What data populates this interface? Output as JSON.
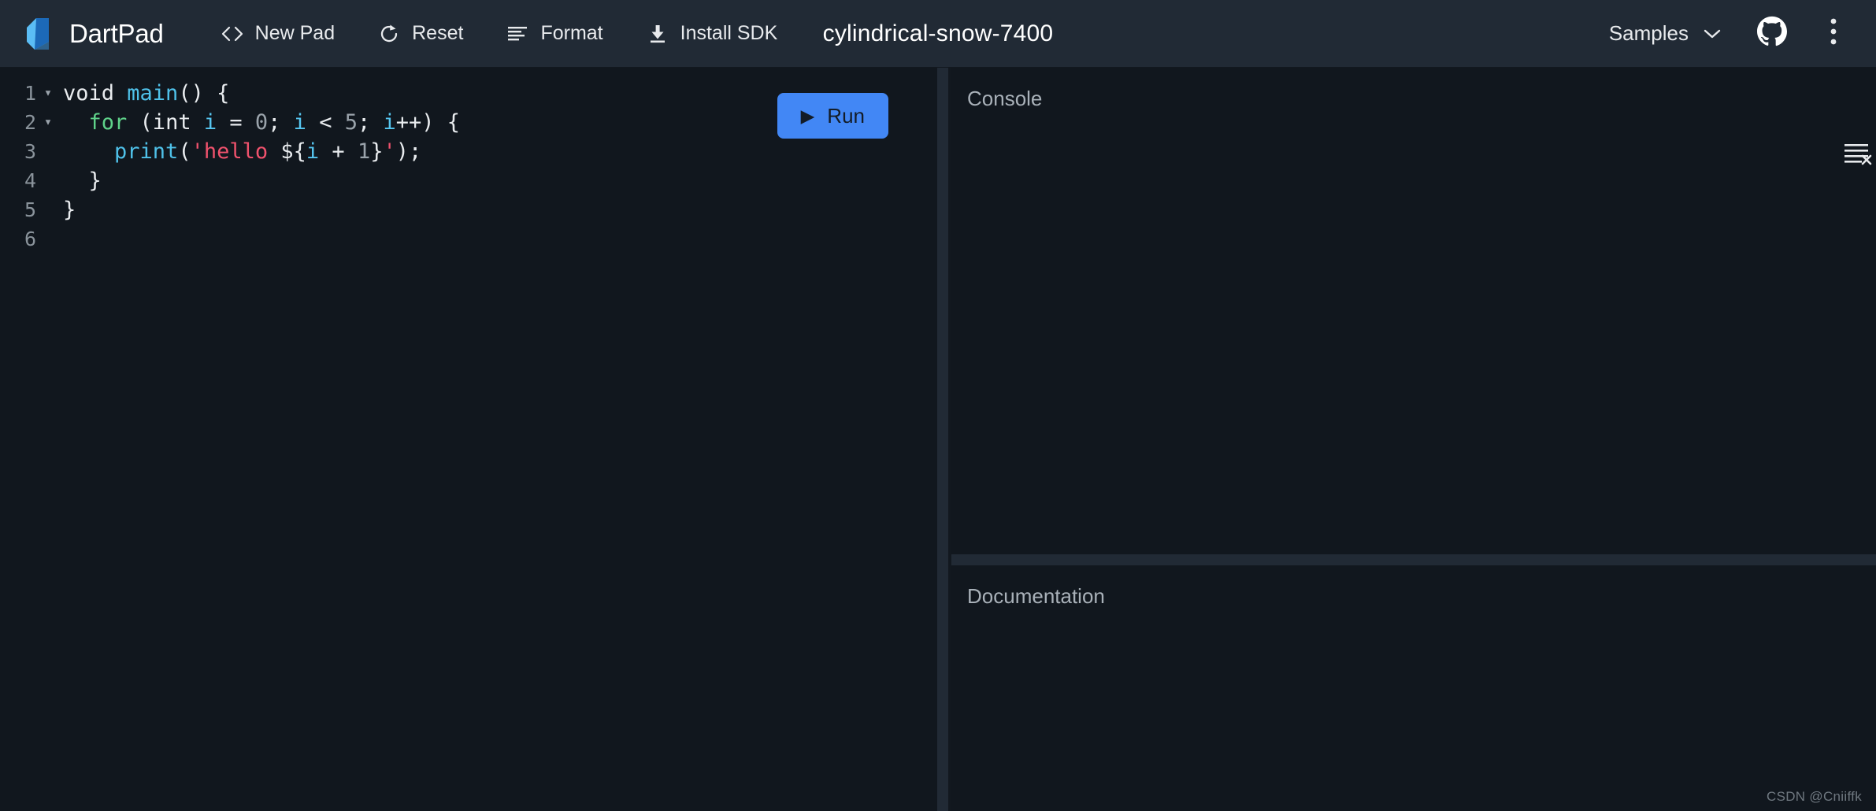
{
  "app": {
    "brand_name": "DartPad",
    "brand_logo_icon": "dart-logo-icon",
    "document_title": "cylindrical-snow-7400",
    "watermark": "CSDN @Cniiffk"
  },
  "header": {
    "actions": [
      {
        "label": "New Pad",
        "icon": "code-brackets-icon"
      },
      {
        "label": "Reset",
        "icon": "refresh-icon"
      },
      {
        "label": "Format",
        "icon": "format-align-left-icon"
      },
      {
        "label": "Install SDK",
        "icon": "download-icon"
      }
    ],
    "samples": {
      "label": "Samples",
      "icon": "chevron-down-icon"
    },
    "github": {
      "icon": "github-icon",
      "label": "GitHub"
    },
    "overflow": {
      "icon": "more-vertical-icon",
      "label": "More actions"
    }
  },
  "editor": {
    "run_button": {
      "label": "Run",
      "icon": "play-icon"
    },
    "gutter_fold_marker": "▾",
    "lines": [
      {
        "number": "1",
        "foldable": true,
        "tokens": [
          {
            "t": "void ",
            "c": "t-plain"
          },
          {
            "t": "main",
            "c": "t-fn"
          },
          {
            "t": "() {",
            "c": "t-punc"
          }
        ]
      },
      {
        "number": "2",
        "foldable": true,
        "tokens": [
          {
            "t": "  ",
            "c": "t-plain"
          },
          {
            "t": "for",
            "c": "t-kw"
          },
          {
            "t": " (int ",
            "c": "t-plain"
          },
          {
            "t": "i",
            "c": "t-var"
          },
          {
            "t": " = ",
            "c": "t-plain"
          },
          {
            "t": "0",
            "c": "t-num"
          },
          {
            "t": "; ",
            "c": "t-punc"
          },
          {
            "t": "i",
            "c": "t-var"
          },
          {
            "t": " < ",
            "c": "t-plain"
          },
          {
            "t": "5",
            "c": "t-num"
          },
          {
            "t": "; ",
            "c": "t-punc"
          },
          {
            "t": "i",
            "c": "t-var"
          },
          {
            "t": "++) {",
            "c": "t-punc"
          }
        ]
      },
      {
        "number": "3",
        "foldable": false,
        "tokens": [
          {
            "t": "    ",
            "c": "t-plain"
          },
          {
            "t": "print",
            "c": "t-fn"
          },
          {
            "t": "(",
            "c": "t-punc"
          },
          {
            "t": "'hello ",
            "c": "t-str"
          },
          {
            "t": "${",
            "c": "t-plain"
          },
          {
            "t": "i",
            "c": "t-var"
          },
          {
            "t": " + ",
            "c": "t-plain"
          },
          {
            "t": "1",
            "c": "t-num"
          },
          {
            "t": "}",
            "c": "t-plain"
          },
          {
            "t": "'",
            "c": "t-str"
          },
          {
            "t": ");",
            "c": "t-punc"
          }
        ]
      },
      {
        "number": "4",
        "foldable": false,
        "tokens": [
          {
            "t": "  }",
            "c": "t-punc"
          }
        ]
      },
      {
        "number": "5",
        "foldable": false,
        "tokens": [
          {
            "t": "}",
            "c": "t-punc"
          }
        ]
      },
      {
        "number": "6",
        "foldable": false,
        "tokens": []
      }
    ]
  },
  "console": {
    "label": "Console",
    "output": "",
    "clear_icon": "clear-console-icon"
  },
  "documentation": {
    "label": "Documentation",
    "content": ""
  },
  "colors": {
    "header_bg": "#212a35",
    "editor_bg": "#11171e",
    "panel_bg": "#11171e",
    "splitter": "#212a35",
    "run_button": "#4287f5",
    "run_button_fg": "#131c27",
    "label_text": "#a9b1b9",
    "keyword": "#5fd28a",
    "function": "#4fc1e9",
    "variable": "#56c6f0",
    "number": "#9aa3ab",
    "string": "#f0526d"
  }
}
